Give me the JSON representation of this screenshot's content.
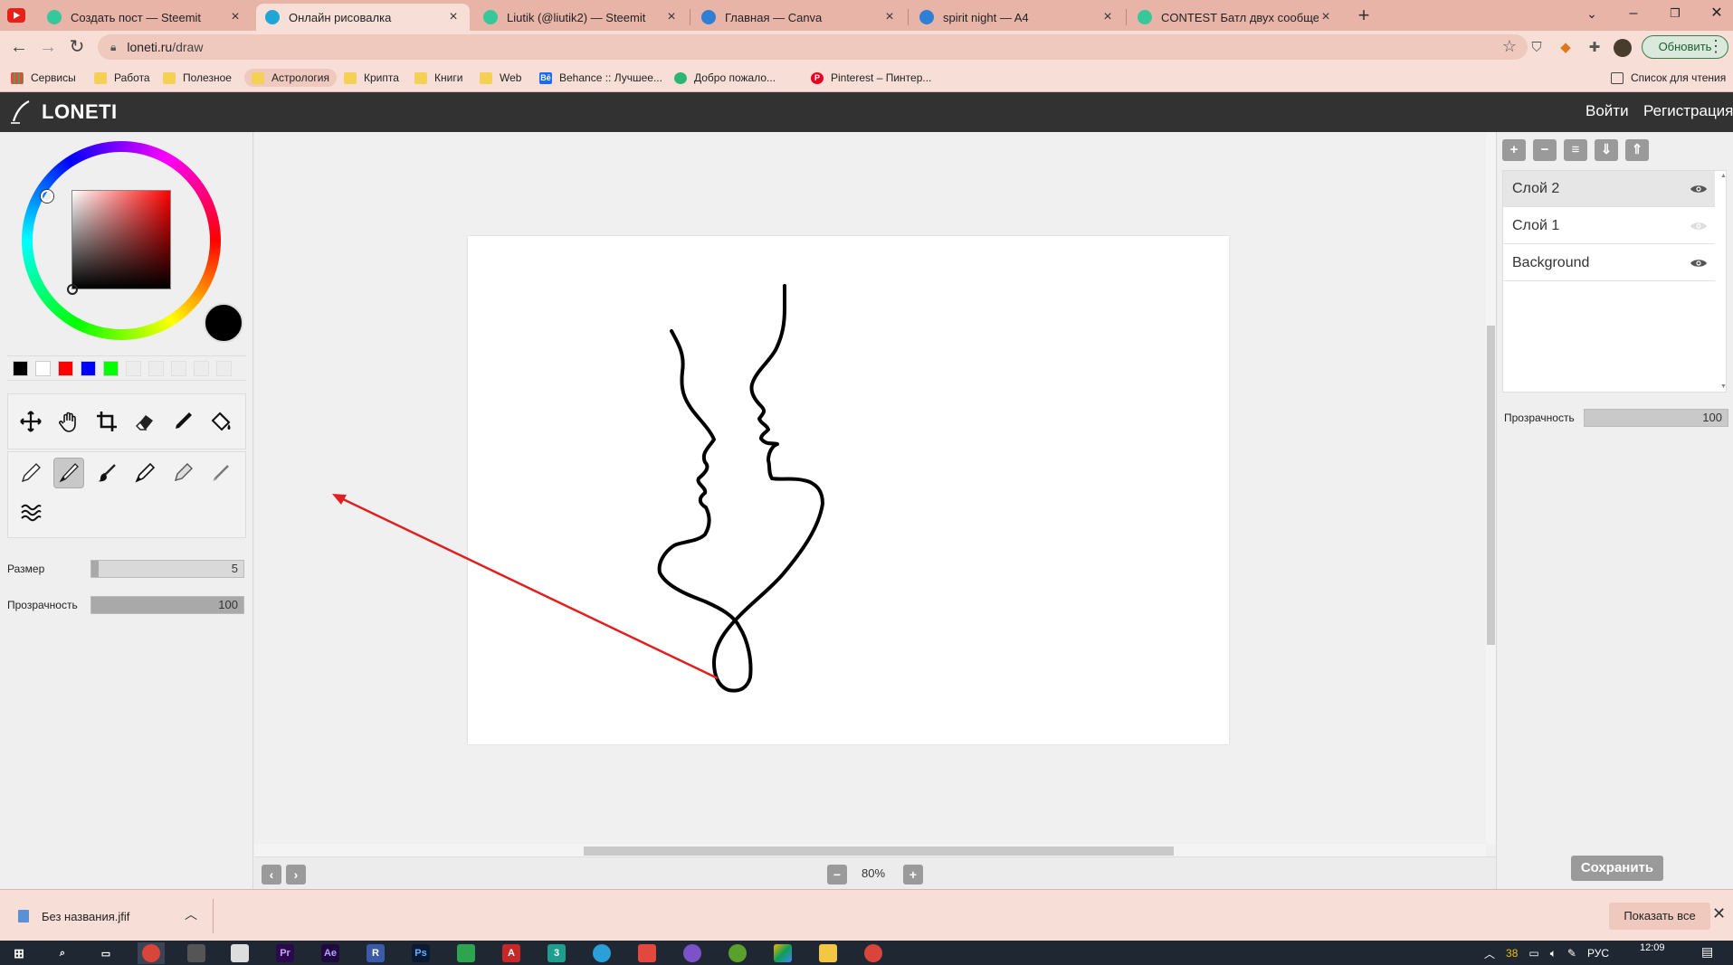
{
  "tabs": [
    {
      "title": "Создать пост — Steemit",
      "icon": "steemit-icon",
      "color": "#36c79a"
    },
    {
      "title": "Онлайн рисовалка",
      "icon": "loneti-icon",
      "color": "#1ea7d6",
      "active": true
    },
    {
      "title": "Liutik (@liutik2) — Steemit",
      "icon": "steemit-icon",
      "color": "#36c79a"
    },
    {
      "title": "Главная — Canva",
      "icon": "canva-icon",
      "color": "#2f7fd6"
    },
    {
      "title": "spirit night — A4",
      "icon": "canva-icon",
      "color": "#2f7fd6"
    },
    {
      "title": "CONTEST Батл двух сообществ",
      "icon": "steemit-icon",
      "color": "#36c79a"
    }
  ],
  "address": {
    "domain": "loneti.ru",
    "path": "/draw"
  },
  "update_label": "Обновить",
  "bookmarks": [
    {
      "label": "Сервисы",
      "icon": "apps-grid-icon"
    },
    {
      "label": "Работа",
      "icon": "folder-icon"
    },
    {
      "label": "Полезное",
      "icon": "folder-icon"
    },
    {
      "label": "Астрология",
      "icon": "folder-icon"
    },
    {
      "label": "Крипта",
      "icon": "folder-icon"
    },
    {
      "label": "Книги",
      "icon": "folder-icon"
    },
    {
      "label": "Web",
      "icon": "folder-icon"
    },
    {
      "label": "Behance :: Лучшее...",
      "icon": "behance-icon"
    },
    {
      "label": "Добро пожало...",
      "icon": "site-icon"
    },
    {
      "label": "Pinterest – Пинтер...",
      "icon": "pinterest-icon"
    }
  ],
  "reading_list": "Список для чтения",
  "app": {
    "logo": "LONETI",
    "login": "Войти",
    "register": "Регистрация"
  },
  "colors": {
    "current": "#000000",
    "palette": [
      "#000000",
      "#ffffff",
      "#ff0000",
      "#0000ff",
      "#00ff00",
      "",
      "",
      "",
      "",
      ""
    ]
  },
  "tools": [
    "move-icon",
    "hand-icon",
    "crop-icon",
    "eraser-icon",
    "eyedropper-icon",
    "fill-icon"
  ],
  "brushes": [
    "pencil-icon",
    "brush-icon",
    "round-brush-icon",
    "pen-icon",
    "marker-icon",
    "airbrush-icon",
    "wave-brush-icon"
  ],
  "selected_brush": 1,
  "size": {
    "label": "Размер",
    "value": 5,
    "max": 100
  },
  "opacity": {
    "label": "Прозрачность",
    "value": 100
  },
  "zoom": "80%",
  "layer_buttons": [
    "+",
    "−",
    "≡",
    "⇓",
    "⇑"
  ],
  "layers": [
    {
      "name": "Слой 2",
      "visible": true,
      "selected": true
    },
    {
      "name": "Слой 1",
      "visible": false
    },
    {
      "name": "Background",
      "visible": true
    }
  ],
  "layer_opacity": {
    "label": "Прозрачность",
    "value": 100
  },
  "save_label": "Сохранить",
  "download": {
    "file": "Без названия.jfif",
    "show_all": "Показать все"
  },
  "taskbar": {
    "time": "12:09",
    "lang": "РУС",
    "temp": "38"
  }
}
